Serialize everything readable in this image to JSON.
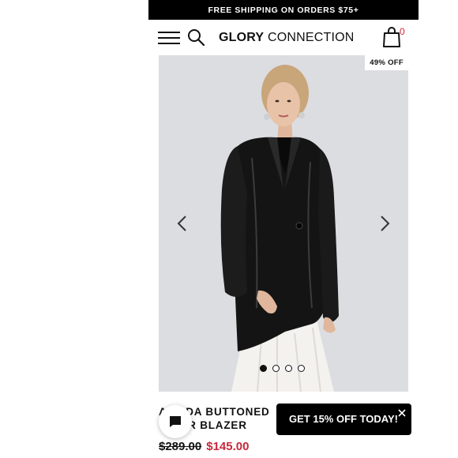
{
  "promo": {
    "text": "FREE SHIPPING ON ORDERS $75+"
  },
  "header": {
    "menu_icon": "hamburger-menu-icon",
    "search_icon": "search-icon",
    "logo": {
      "bold": "GLORY",
      "light": " CONNECTION"
    },
    "cart_icon": "shopping-bag-icon",
    "cart_count": "0"
  },
  "gallery": {
    "badge": "49% OFF",
    "prev_icon": "chevron-left-icon",
    "next_icon": "chevron-right-icon",
    "active_index": 0,
    "slide_count": 4
  },
  "product": {
    "title_line1": "A   NDA BUTTONED",
    "title_line2": "      ER BLAZER",
    "old_price": "$289.00",
    "sale_price": "$145.00"
  },
  "chat": {
    "icon": "chat-bubble-icon"
  },
  "popup": {
    "text": "GET 15% OFF TODAY!",
    "close_icon": "close-icon"
  },
  "colors": {
    "accent": "#c8283a",
    "image_bg": "#dcdde1",
    "bar": "#000000"
  }
}
